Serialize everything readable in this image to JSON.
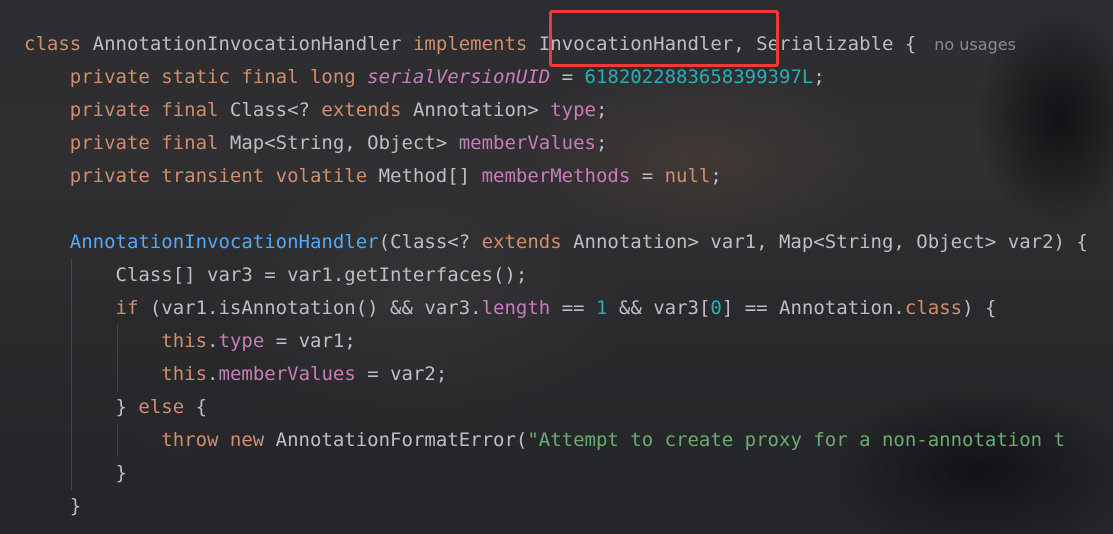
{
  "code_lines": [
    {
      "tokens": [
        {
          "t": "class ",
          "c": "kw"
        },
        {
          "t": "AnnotationInvocationHandler ",
          "c": "plain"
        },
        {
          "t": "implements ",
          "c": "kw"
        },
        {
          "t": "InvocationHandler",
          "c": "plain"
        },
        {
          "t": ", Serializable {",
          "c": "plain"
        }
      ],
      "hint": "no usages"
    },
    {
      "tokens": [
        {
          "t": "    private static final long ",
          "c": "kw"
        },
        {
          "t": "serialVersionUID",
          "c": "sfld"
        },
        {
          "t": " = ",
          "c": "plain"
        },
        {
          "t": "6182022883658399397L",
          "c": "num"
        },
        {
          "t": ";",
          "c": "plain"
        }
      ]
    },
    {
      "tokens": [
        {
          "t": "    private final ",
          "c": "kw"
        },
        {
          "t": "Class<? ",
          "c": "plain"
        },
        {
          "t": "extends ",
          "c": "kw"
        },
        {
          "t": "Annotation> ",
          "c": "plain"
        },
        {
          "t": "type",
          "c": "fld"
        },
        {
          "t": ";",
          "c": "plain"
        }
      ]
    },
    {
      "tokens": [
        {
          "t": "    private final ",
          "c": "kw"
        },
        {
          "t": "Map<String, Object> ",
          "c": "plain"
        },
        {
          "t": "memberValues",
          "c": "fld"
        },
        {
          "t": ";",
          "c": "plain"
        }
      ]
    },
    {
      "tokens": [
        {
          "t": "    private transient volatile ",
          "c": "kw"
        },
        {
          "t": "Method[] ",
          "c": "plain"
        },
        {
          "t": "memberMethods",
          "c": "fld"
        },
        {
          "t": " = ",
          "c": "plain"
        },
        {
          "t": "null",
          "c": "kw"
        },
        {
          "t": ";",
          "c": "plain"
        }
      ]
    },
    {
      "tokens": []
    },
    {
      "tokens": [
        {
          "t": "    ",
          "c": "plain"
        },
        {
          "t": "AnnotationInvocationHandler",
          "c": "fn"
        },
        {
          "t": "(Class<? ",
          "c": "plain"
        },
        {
          "t": "extends ",
          "c": "kw"
        },
        {
          "t": "Annotation> var1, Map<String, Object> var2) {",
          "c": "plain"
        }
      ]
    },
    {
      "tokens": [
        {
          "t": "        Class[] var3 = var1.getInterfaces();",
          "c": "plain"
        }
      ]
    },
    {
      "tokens": [
        {
          "t": "        ",
          "c": "plain"
        },
        {
          "t": "if ",
          "c": "kw"
        },
        {
          "t": "(var1.isAnnotation() && var3.",
          "c": "plain"
        },
        {
          "t": "length",
          "c": "fld"
        },
        {
          "t": " == ",
          "c": "plain"
        },
        {
          "t": "1",
          "c": "num"
        },
        {
          "t": " && var3[",
          "c": "plain"
        },
        {
          "t": "0",
          "c": "num"
        },
        {
          "t": "] == Annotation.",
          "c": "plain"
        },
        {
          "t": "class",
          "c": "kw"
        },
        {
          "t": ") {",
          "c": "plain"
        }
      ]
    },
    {
      "tokens": [
        {
          "t": "            ",
          "c": "plain"
        },
        {
          "t": "this",
          "c": "kw"
        },
        {
          "t": ".",
          "c": "plain"
        },
        {
          "t": "type",
          "c": "fld"
        },
        {
          "t": " = var1;",
          "c": "plain"
        }
      ]
    },
    {
      "tokens": [
        {
          "t": "            ",
          "c": "plain"
        },
        {
          "t": "this",
          "c": "kw"
        },
        {
          "t": ".",
          "c": "plain"
        },
        {
          "t": "memberValues",
          "c": "fld"
        },
        {
          "t": " = var2;",
          "c": "plain"
        }
      ]
    },
    {
      "tokens": [
        {
          "t": "        } ",
          "c": "plain"
        },
        {
          "t": "else",
          "c": "kw"
        },
        {
          "t": " {",
          "c": "plain"
        }
      ]
    },
    {
      "tokens": [
        {
          "t": "            ",
          "c": "plain"
        },
        {
          "t": "throw new ",
          "c": "kw"
        },
        {
          "t": "AnnotationFormatError(",
          "c": "plain"
        },
        {
          "t": "\"Attempt to create proxy for a non-annotation t",
          "c": "str"
        }
      ]
    },
    {
      "tokens": [
        {
          "t": "        }",
          "c": "plain"
        }
      ]
    },
    {
      "tokens": [
        {
          "t": "    }",
          "c": "plain"
        }
      ]
    }
  ],
  "theme": {
    "keyword": "#cf8e6d",
    "field": "#c77dbb",
    "number": "#2aacb8",
    "string": "#6aab73",
    "method": "#56a8f5",
    "text": "#bcbec4",
    "hint": "#868a91",
    "highlight_box": "#ee3a3a"
  }
}
